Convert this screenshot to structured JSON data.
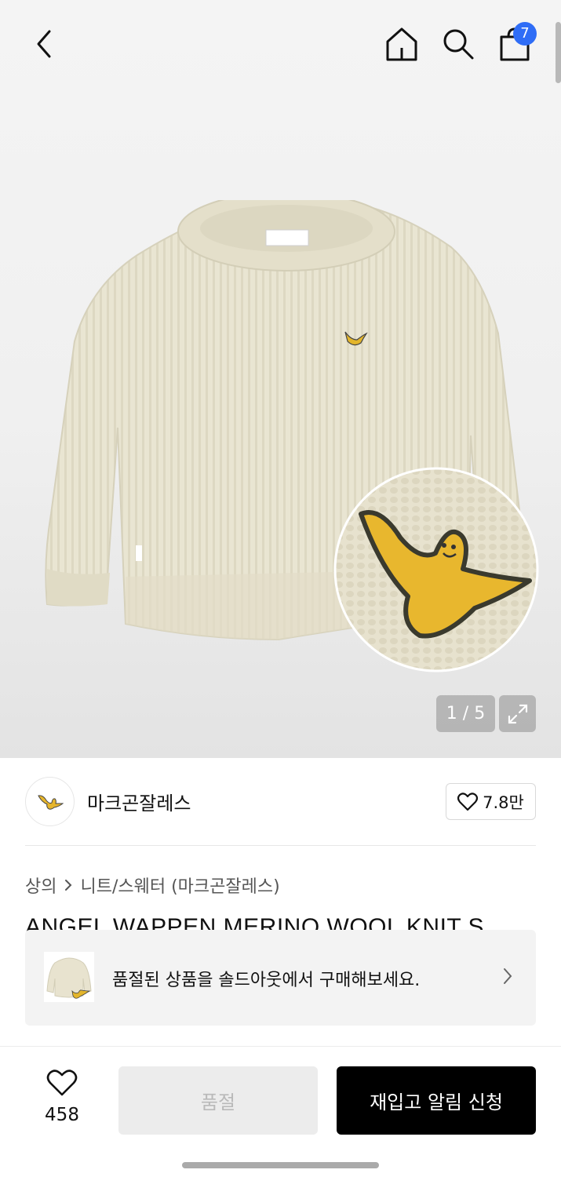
{
  "header": {
    "back_icon": "chevron-left-icon",
    "home_icon": "home-icon",
    "search_icon": "search-icon",
    "cart_icon": "shopping-bag-icon",
    "cart_count": "7",
    "badge_color": "#2f6df6"
  },
  "gallery": {
    "pager": "1 / 5",
    "expand_icon": "expand-icon"
  },
  "brand": {
    "name": "마크곤잘레스",
    "likes": "7.8만",
    "heart_icon": "heart-outline-icon"
  },
  "breadcrumb": {
    "category": "상의",
    "subcategory": "니트/스웨터 (마크곤잘레스)"
  },
  "product": {
    "title": "ANGEL WAPPEN MERINO WOOL KNIT S"
  },
  "soldout_banner": {
    "text": "품절된 상품을 솔드아웃에서 구매해보세요."
  },
  "bottom_bar": {
    "wish_count": "458",
    "soldout_label": "품절",
    "restock_label": "재입고 알림 신청"
  }
}
